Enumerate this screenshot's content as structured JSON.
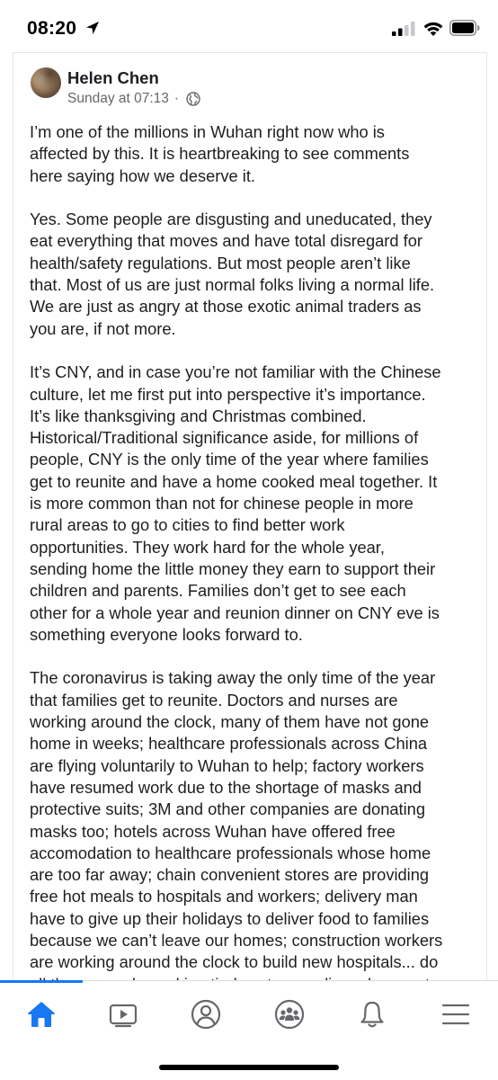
{
  "status_bar": {
    "time": "08:20"
  },
  "post": {
    "author": "Helen Chen",
    "timestamp": "Sunday at 07:13",
    "separator": "·",
    "paragraphs": [
      [
        "I’m one of the millions in Wuhan right now who is",
        "affected by this. It is heartbreaking to see comments",
        "here saying how we deserve it."
      ],
      [
        "Yes. Some people are disgusting and uneducated, they",
        "eat everything that moves and have total disregard for",
        "health/safety regulations. But most people aren’t like",
        "that. Most of us are just normal folks living a normal life.",
        "We are just as angry at those exotic animal traders as",
        "you are, if not more."
      ],
      [
        "It’s CNY, and in case you’re not familiar with the Chinese",
        "culture, let me first put into perspective it’s importance.",
        "It’s like thanksgiving and Christmas combined.",
        "Historical/Traditional significance aside, for millions of",
        "people, CNY is the only time of the year where families",
        "get to reunite and have a home cooked meal together. It",
        "is more common than not for chinese people in more",
        "rural areas to go to cities to find better work",
        "opportunities. They work hard for the whole year,",
        "sending home the little money they earn to support their",
        "children and parents. Families don’t get to see each",
        "other for a whole year and reunion dinner on CNY eve is",
        "something everyone looks forward to."
      ],
      [
        "The coronavirus is taking away the only time of the year",
        "that families get to reunite. Doctors and nurses are",
        "working around the clock, many of them have not gone",
        "home in weeks; healthcare professionals across China",
        "are flying voluntarily to Wuhan to help; factory workers",
        "have resumed work due to the shortage of masks and",
        "protective suits; 3M and other companies are donating",
        "masks too; hotels across Wuhan have offered free",
        "accomodation to healthcare professionals whose home",
        "are too far away; chain convenient stores are providing",
        "free hot meals to hospitals and workers; delivery man",
        "have to give up their holidays to deliver food to families",
        "because we can’t leave our homes; construction workers",
        "are working around the clock to build new hospitals... do",
        "all these people working tireless to save lives deserve to"
      ]
    ]
  },
  "colors": {
    "accent": "#1877f2",
    "icon_gray": "#65676b",
    "text": "#1c1e21"
  },
  "tab_bar": {
    "active": "home",
    "tabs": [
      "home-icon",
      "video-icon",
      "profile-icon",
      "groups-icon",
      "notifications-icon",
      "menu-icon"
    ]
  }
}
